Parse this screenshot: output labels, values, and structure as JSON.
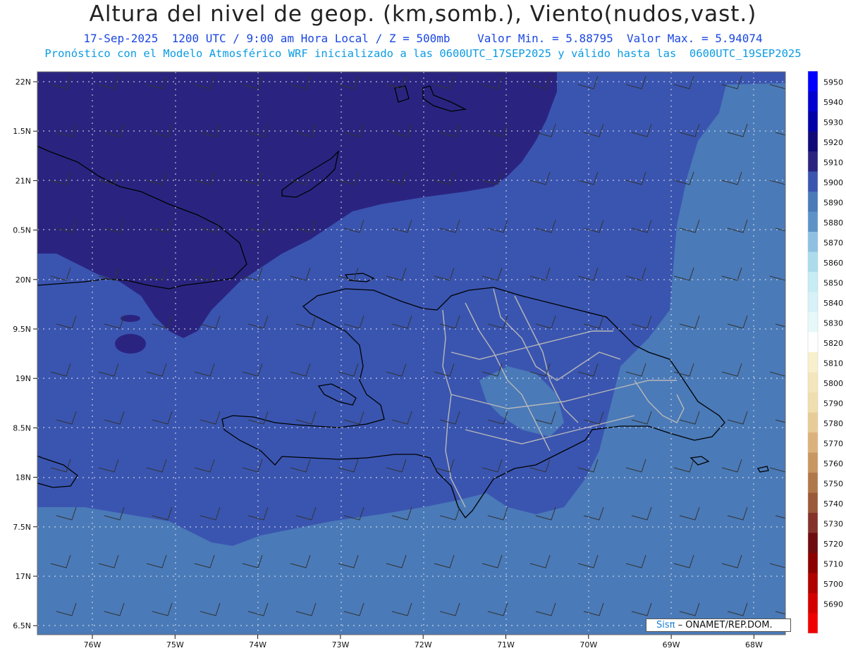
{
  "title": "Altura del nivel de geop. (km,somb.), Viento(nudos,vast.)",
  "subtitle_line1": "17-Sep-2025  1200 UTC / 9:00 am Hora Local / Z = 500mb    Valor Min. = 5.88795  Valor Max. = 5.94074",
  "subtitle_line2": "Pronóstico con el Modelo Atmosférico WRF inicializado a las 0600UTC_17SEP2025 y válido hasta las  0600UTC_19SEP2025",
  "latitude_labels": [
    "22N",
    "1.5N",
    "21N",
    "0.5N",
    "20N",
    "9.5N",
    "19N",
    "8.5N",
    "18N",
    "7.5N",
    "17N",
    "6.5N"
  ],
  "longitude_labels": [
    "76W",
    "75W",
    "74W",
    "73W",
    "72W",
    "71W",
    "70W",
    "69W",
    "68W"
  ],
  "colorbar": {
    "levels": [
      "5950",
      "5940",
      "5930",
      "5920",
      "5910",
      "5900",
      "5890",
      "5880",
      "5870",
      "5860",
      "5850",
      "5840",
      "5830",
      "5820",
      "5810",
      "5800",
      "5790",
      "5780",
      "5770",
      "5760",
      "5750",
      "5740",
      "5730",
      "5720",
      "5710",
      "5700",
      "5690"
    ],
    "colors": [
      "#0000ff",
      "#0000d0",
      "#0000a8",
      "#100a78",
      "#2a2480",
      "#3a55b0",
      "#4a7ab8",
      "#5e93c8",
      "#8ec0e2",
      "#acdcec",
      "#c6ecf4",
      "#d6f2f8",
      "#e6f8fa",
      "#ffffff",
      "#f8f0cc",
      "#f4e6bc",
      "#f0deaf",
      "#e8cc98",
      "#dcb27c",
      "#c89660",
      "#b0784a",
      "#9a5a3a",
      "#84322a",
      "#6e0c10",
      "#8c0000",
      "#b00000",
      "#d40000",
      "#f00000"
    ]
  },
  "colors": {
    "level_5920": "#2a2480",
    "level_5910": "#3a55b0",
    "level_5900": "#4a7ab8",
    "level_5890": "#5e93c8",
    "coastline": "#000000",
    "province_borders": "#b8b8b8",
    "gridlines": "#e8e8e8",
    "wind_barbs": "#333333"
  },
  "credit": {
    "sis": "Sisπ",
    "org": "– ONAMET/REP.DOM."
  }
}
